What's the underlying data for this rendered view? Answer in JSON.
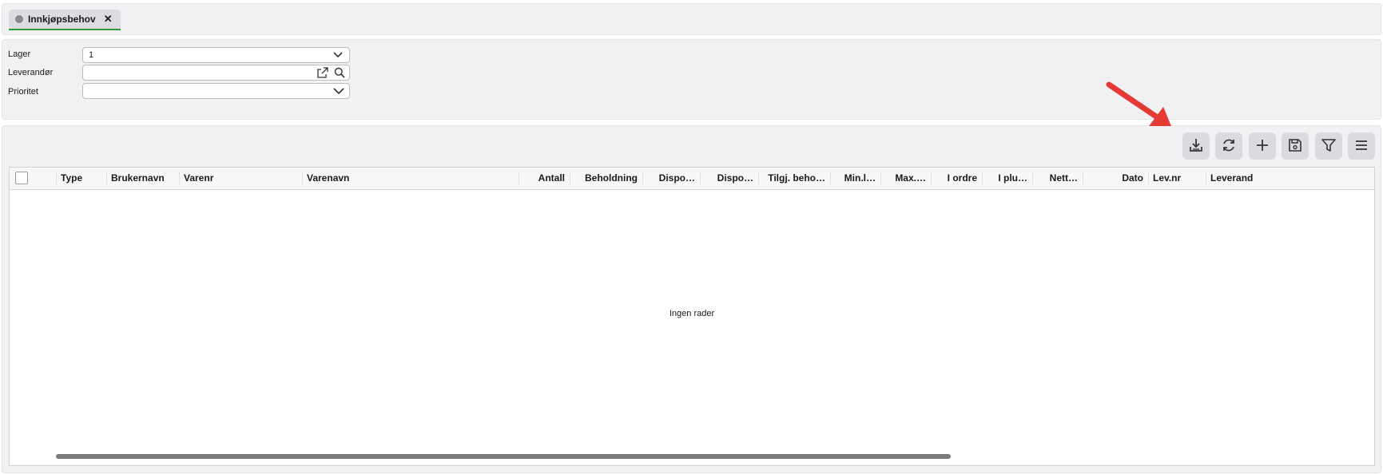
{
  "tabs": [
    {
      "label": "Innkjøpsbehov",
      "close": "✕"
    }
  ],
  "form": {
    "lager": {
      "label": "Lager",
      "value": "1"
    },
    "leverandor": {
      "label": "Leverandør",
      "value": "",
      "placeholder": ""
    },
    "prioritet": {
      "label": "Prioritet",
      "value": ""
    }
  },
  "toolbar": {
    "buttons": [
      "download-icon",
      "refresh-icon",
      "plus-icon",
      "save-icon",
      "filter-icon",
      "menu-icon"
    ]
  },
  "table": {
    "columns": [
      "Type",
      "Brukernavn",
      "Varenr",
      "Varenavn",
      "Antall",
      "Beholdning",
      "Dispo…",
      "Dispo…",
      "Tilgj. beho…",
      "Min.l…",
      "Max.…",
      "I ordre",
      "I plu…",
      "Nett…",
      "Dato",
      "Lev.nr",
      "Leverand"
    ],
    "empty_text": "Ingen rader"
  },
  "colors": {
    "accent_tab": "#2e9b3a",
    "annotation_arrow": "#e53935"
  }
}
